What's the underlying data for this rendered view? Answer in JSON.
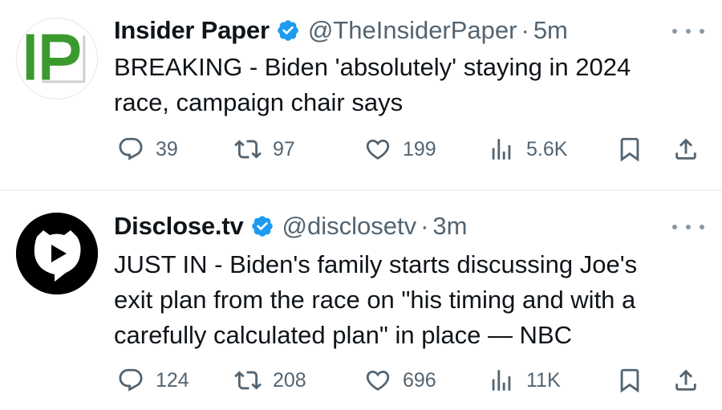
{
  "tweets": [
    {
      "display_name": "Insider Paper",
      "handle": "@TheInsiderPaper",
      "separator": "·",
      "time": "5m",
      "avatar": {
        "text": "IP",
        "icon": "insider-paper-logo",
        "color": "#3a9a2e"
      },
      "text": "BREAKING - Biden 'absolutely' staying in 2024\nrace, campaign chair says",
      "stats": {
        "replies": "39",
        "reposts": "97",
        "likes": "199",
        "views": "5.6K"
      }
    },
    {
      "display_name": "Disclose.tv",
      "handle": "@disclosetv",
      "separator": "·",
      "time": "3m",
      "avatar": {
        "icon": "disclosetv-logo",
        "color": "#000000"
      },
      "text": "JUST IN - Biden's family starts discussing Joe's\nexit plan from the race on \"his timing and with a\ncarefully calculated plan\" in place — NBC",
      "stats": {
        "replies": "124",
        "reposts": "208",
        "likes": "696",
        "views": "11K"
      }
    }
  ],
  "icons": {
    "verified": "verified-badge-icon",
    "more": "more-icon",
    "reply": "reply-icon",
    "repost": "repost-icon",
    "like": "heart-icon",
    "views": "views-icon",
    "bookmark": "bookmark-icon",
    "share": "share-icon"
  },
  "colors": {
    "text": "#0f1419",
    "secondary": "#536471",
    "verified": "#1d9bf0",
    "divider": "#eff3f4"
  }
}
